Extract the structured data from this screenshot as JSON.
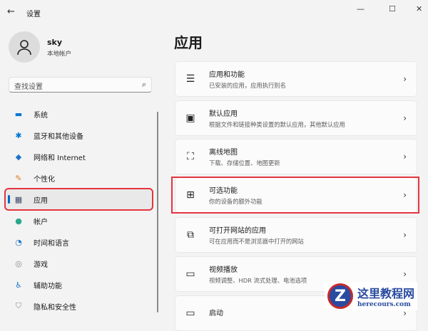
{
  "window": {
    "title": "设置",
    "back_icon": "←",
    "minimize": "—",
    "maximize": "☐",
    "close": "✕"
  },
  "user": {
    "name": "sky",
    "account_type": "本地帐户"
  },
  "search": {
    "placeholder": "查找设置",
    "icon": "⌕"
  },
  "sidebar": {
    "items": [
      {
        "label": "系统",
        "icon": "▬",
        "color": "#0078d4"
      },
      {
        "label": "蓝牙和其他设备",
        "icon": "✱",
        "color": "#0078d4"
      },
      {
        "label": "网络和 Internet",
        "icon": "◆",
        "color": "#1a73c8"
      },
      {
        "label": "个性化",
        "icon": "✎",
        "color": "#e07a1f"
      },
      {
        "label": "应用",
        "icon": "▦",
        "color": "#3a4a6b",
        "selected": true
      },
      {
        "label": "帐户",
        "icon": "●",
        "color": "#2aa788"
      },
      {
        "label": "时间和语言",
        "icon": "◔",
        "color": "#1a73c8"
      },
      {
        "label": "游戏",
        "icon": "◎",
        "color": "#8a8a8a"
      },
      {
        "label": "辅助功能",
        "icon": "♿",
        "color": "#1a73c8"
      },
      {
        "label": "隐私和安全性",
        "icon": "⛉",
        "color": "#8a8a8a"
      }
    ]
  },
  "main": {
    "title": "应用",
    "cards": [
      {
        "title": "应用和功能",
        "subtitle": "已安装的应用，应用执行别名",
        "icon": "☰"
      },
      {
        "title": "默认应用",
        "subtitle": "根据文件和链接种类设置的默认应用，其他默认应用",
        "icon": "▣"
      },
      {
        "title": "离线地图",
        "subtitle": "下载、存储位置、地图更新",
        "icon": "⛶"
      },
      {
        "title": "可选功能",
        "subtitle": "你的设备的额外功能",
        "icon": "⊞"
      },
      {
        "title": "可打开网站的应用",
        "subtitle": "可在应用而不是浏览器中打开的网站",
        "icon": "⧉"
      },
      {
        "title": "视频播放",
        "subtitle": "视频调整、HDR 流式处理、电池选项",
        "icon": "▭"
      },
      {
        "title": "启动",
        "subtitle": "",
        "icon": "▭"
      }
    ],
    "chevron": "›"
  },
  "watermark": {
    "name": "这里教程网",
    "url": "herecours.com",
    "logo": "Z"
  }
}
